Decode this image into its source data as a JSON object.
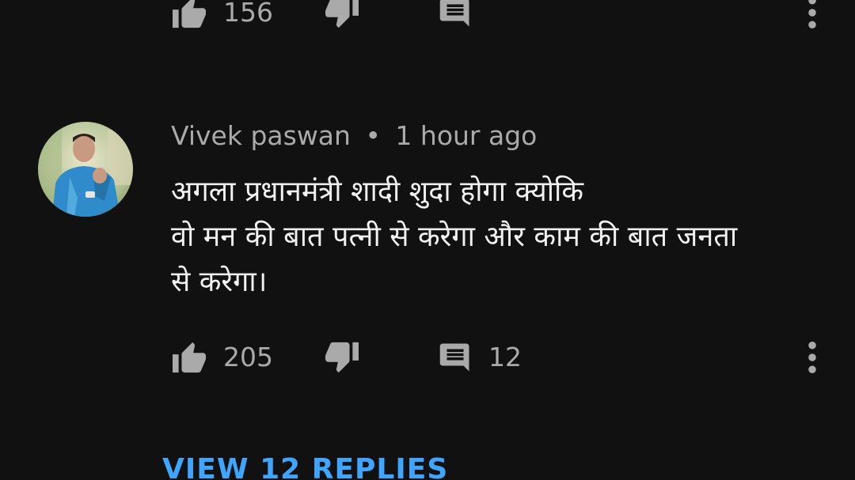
{
  "previous_comment": {
    "like_count": "156"
  },
  "comment": {
    "author": "Vivek paswan",
    "separator": "•",
    "timestamp": "1 hour ago",
    "text_line_1": "अगला प्रधानमंत्री शादी शुदा होगा क्योकि",
    "text_line_2": "वो मन की बात पत्नी से करेगा और काम की बात जनता",
    "text_line_3": "से करेगा।",
    "like_count": "205",
    "reply_count": "12"
  },
  "view_replies_label": "VIEW 12 REPLIES",
  "icons": {
    "like": "thumb-up-icon",
    "dislike": "thumb-down-icon",
    "reply": "comment-icon",
    "more": "more-vertical-icon"
  },
  "colors": {
    "background": "#111111",
    "text_primary": "#f1f1f1",
    "text_secondary": "#aaaaaa",
    "accent_link": "#3ea6ff"
  }
}
